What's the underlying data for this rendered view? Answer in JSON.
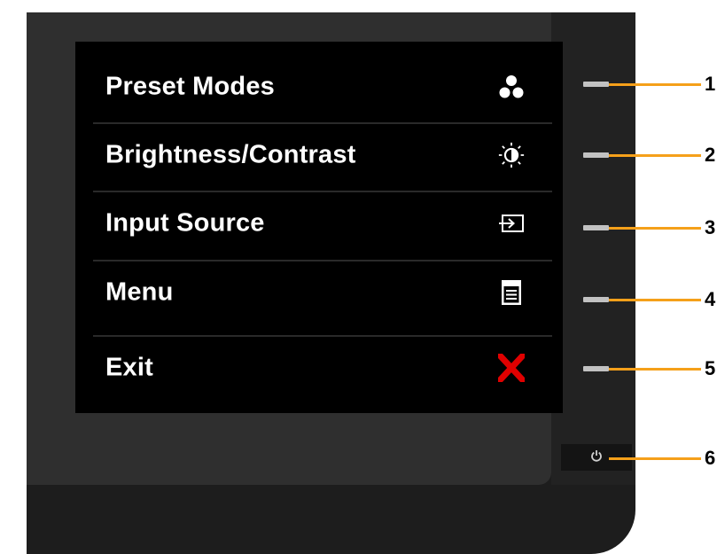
{
  "osd_menu": {
    "items": [
      {
        "label": "Preset Modes",
        "icon": "preset-dots-icon"
      },
      {
        "label": "Brightness/Contrast",
        "icon": "brightness-icon"
      },
      {
        "label": "Input Source",
        "icon": "input-source-icon"
      },
      {
        "label": "Menu",
        "icon": "menu-icon"
      },
      {
        "label": "Exit",
        "icon": "exit-x-icon"
      }
    ]
  },
  "callouts": [
    "1",
    "2",
    "3",
    "4",
    "5",
    "6"
  ],
  "colors": {
    "osd_background": "#000000",
    "bezel": "#1d1d1d",
    "panel": "#2f2f2f",
    "callout_line": "#f5a01a",
    "exit_icon": "#e00000",
    "button": "#c2c2c2"
  }
}
